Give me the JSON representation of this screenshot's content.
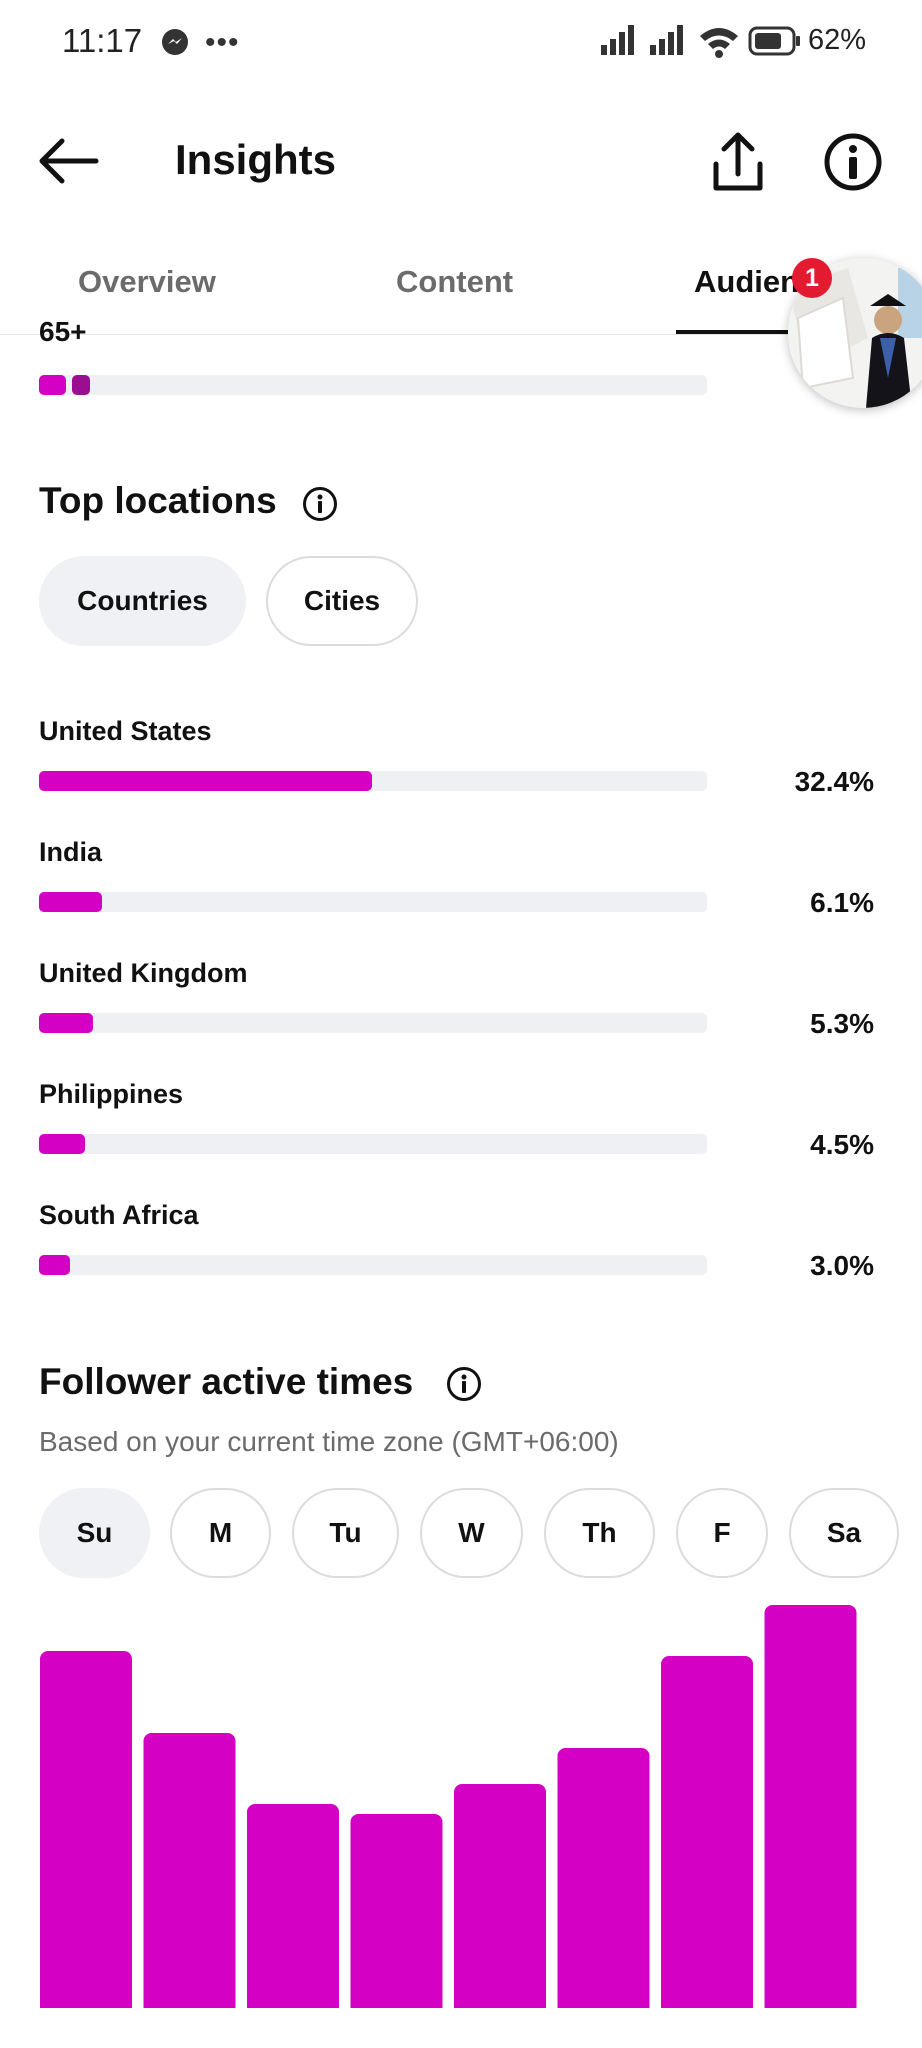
{
  "status_bar": {
    "time": "11:17",
    "battery": "62%"
  },
  "header": {
    "title": "Insights"
  },
  "tabs": [
    {
      "label": "Overview"
    },
    {
      "label": "Content"
    },
    {
      "label": "Audien"
    }
  ],
  "notification_count": "1",
  "age": {
    "label": "65+"
  },
  "top_locations": {
    "title": "Top locations",
    "filters": [
      {
        "label": "Countries",
        "selected": true
      },
      {
        "label": "Cities",
        "selected": false
      }
    ],
    "items": [
      {
        "name": "United States",
        "value": "32.4%",
        "percent": 32.4
      },
      {
        "name": "India",
        "value": "6.1%",
        "percent": 6.1
      },
      {
        "name": "United Kingdom",
        "value": "5.3%",
        "percent": 5.3
      },
      {
        "name": "Philippines",
        "value": "4.5%",
        "percent": 4.5
      },
      {
        "name": "South Africa",
        "value": "3.0%",
        "percent": 3.0
      }
    ]
  },
  "active_times": {
    "title": "Follower active times",
    "subtitle": "Based on your current time zone (GMT+06:00)",
    "days": [
      {
        "label": "Su",
        "selected": true
      },
      {
        "label": "M",
        "selected": false
      },
      {
        "label": "Tu",
        "selected": false
      },
      {
        "label": "W",
        "selected": false
      },
      {
        "label": "Th",
        "selected": false
      },
      {
        "label": "F",
        "selected": false
      },
      {
        "label": "Sa",
        "selected": false
      }
    ]
  },
  "colors": {
    "accent": "#d400c4",
    "accent_dark": "#9b0d91",
    "track": "#eef0f3",
    "badge": "#e21b30"
  },
  "chart_data": {
    "type": "bar",
    "values": [
      70,
      54,
      40,
      38,
      44,
      51,
      69,
      79
    ],
    "ylim": [
      0,
      80
    ]
  }
}
